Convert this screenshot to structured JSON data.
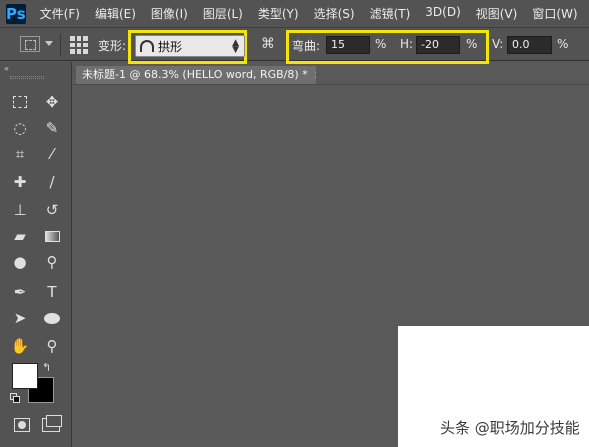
{
  "app": {
    "logo": "Ps"
  },
  "menu": {
    "items": [
      "文件(F)",
      "编辑(E)",
      "图像(I)",
      "图层(L)",
      "类型(Y)",
      "选择(S)",
      "滤镜(T)",
      "3D(D)",
      "视图(V)",
      "窗口(W)"
    ]
  },
  "options": {
    "warp_label": "变形:",
    "warp_style": "拱形",
    "bend_label": "弯曲:",
    "bend_value": "15",
    "bend_unit": "%",
    "h_label": "H:",
    "h_value": "-20",
    "h_unit": "%",
    "v_label": "V:",
    "v_value": "0.0",
    "v_unit": "%"
  },
  "document": {
    "tab_title": "未标题-1 @ 68.3% (HELLO word, RGB/8) *",
    "close_glyph": "×"
  },
  "toolbox": {
    "collapse_glyph": "«",
    "tools": [
      "rect-marquee-icon",
      "move-icon",
      "lasso-icon",
      "quick-select-icon",
      "crop-icon",
      "eyedropper-icon",
      "healing-brush-icon",
      "brush-icon",
      "clone-stamp-icon",
      "history-brush-icon",
      "eraser-icon",
      "gradient-icon",
      "blur-icon",
      "dodge-icon",
      "pen-icon",
      "type-icon",
      "path-select-icon",
      "ellipse-icon",
      "hand-icon",
      "zoom-icon"
    ],
    "foreground_color": "#ffffff",
    "background_color": "#000000"
  },
  "watermark": {
    "text": "头条 @职场加分技能"
  },
  "colors": {
    "highlight": "#f2e600",
    "chrome": "#535353",
    "workspace": "#595959"
  }
}
